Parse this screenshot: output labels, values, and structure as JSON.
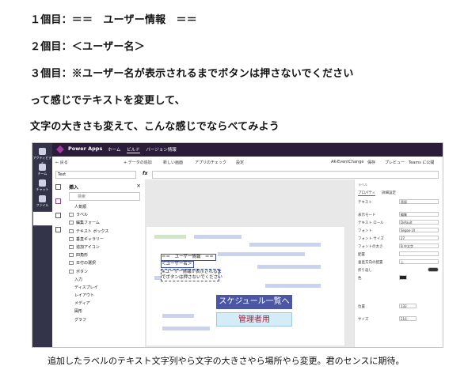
{
  "instructions": {
    "line1": "１個目：＝＝　ユーザー情報　＝＝",
    "line2": "２個目：＜ユーザー名＞",
    "line3": "３個目：※ユーザー名が表示されるまでボタンは押さないでください",
    "line4": "って感じでテキストを変更して、",
    "line5": "文字の大きさも変えて、こんな感じでならべてみよう"
  },
  "screenshot": {
    "rail": [
      "アクティビティ",
      "チーム",
      "チャット",
      "ファイル",
      "Power Apps"
    ],
    "app_title": "Power Apps",
    "nav": [
      "ホーム",
      "ビルド",
      "バージョン情報"
    ],
    "cmd": {
      "back": "← 戻る",
      "add_data": "+ データの追加",
      "new_screen": "新しい画面",
      "app_check": "アプリのチェック",
      "settings": "設定",
      "env": "AK-EventChange",
      "save": "保存",
      "preview": "プレビュー",
      "publish": "Teams に公開"
    },
    "formula": {
      "property": "Text",
      "fx": "fx"
    },
    "insert_panel": {
      "title": "挿入",
      "search_placeholder": "検索",
      "items": [
        "人気順",
        "ラベル",
        "編集フォーム",
        "テキスト ボックス",
        "垂直ギャラリー",
        "追加アイコン",
        "四角形",
        "日付の選択",
        "ボタン",
        "入力",
        "ディスプレイ",
        "レイアウト",
        "メディア",
        "図形",
        "グラフ"
      ]
    },
    "canvas": {
      "label1": "＝＝　ユーザー情報　＝＝",
      "label2": "＜ユーザー名＞",
      "label3a": "※ユーザー情報が表示されるま",
      "label3b": "でボタンは押さないでください",
      "btn_schedule": "スケジュール一覧へ",
      "btn_admin": "管理者用"
    },
    "props": {
      "header": "ラベル",
      "tabs": [
        "プロパティ",
        "詳細設定"
      ],
      "rows": [
        [
          "テキスト",
          "直接"
        ],
        [
          "表示モード",
          "編集"
        ],
        [
          "テキスト ロール",
          "Default"
        ],
        [
          "フォント",
          "Segoe UI"
        ],
        [
          "フォント サイズ",
          "27"
        ],
        [
          "フォントの太さ",
          "B 中太字"
        ],
        [
          "配置",
          ""
        ],
        [
          "垂直方向の配置",
          "上"
        ],
        [
          "折り返し",
          ""
        ],
        [
          "色",
          ""
        ],
        [
          "位置",
          "132"
        ],
        [
          "サイズ",
          "216"
        ]
      ]
    }
  },
  "caption": "追加したラベルのテキスト文字列やら文字の大きさやら場所やら変更。君のセンスに期待。"
}
